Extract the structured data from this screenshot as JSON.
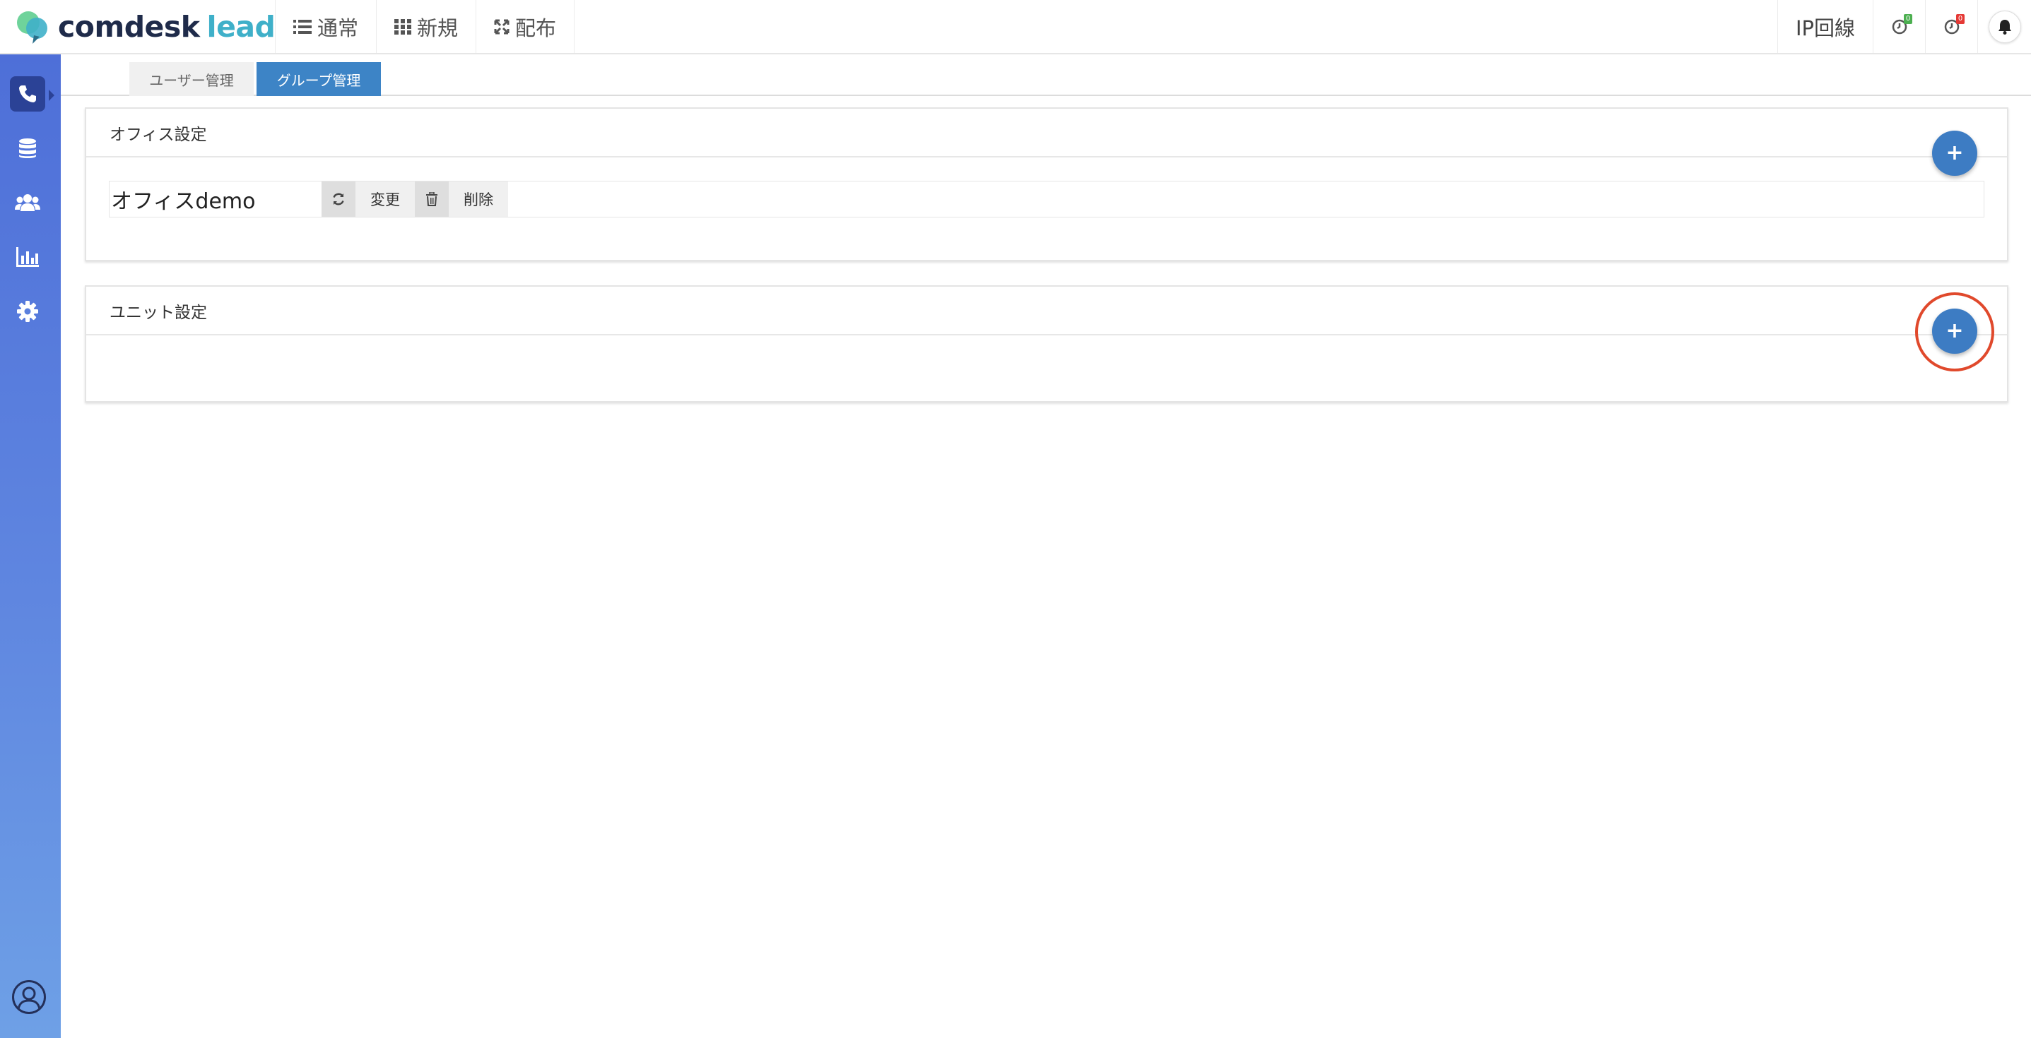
{
  "brand": {
    "name_primary": "comdesk",
    "name_secondary": "lead"
  },
  "nav": {
    "items": [
      {
        "label": "通常",
        "icon": "list-icon"
      },
      {
        "label": "新規",
        "icon": "grid-icon"
      },
      {
        "label": "配布",
        "icon": "expand-icon"
      }
    ]
  },
  "header_right": {
    "ip_line_label": "IP回線",
    "timer_green_badge": "0",
    "timer_red_badge": "0"
  },
  "sidebar": {
    "items": [
      "phone-icon",
      "database-icon",
      "users-icon",
      "bar-chart-icon",
      "gear-icon"
    ],
    "active_index": 0
  },
  "tabs": [
    {
      "label": "ユーザー管理",
      "active": false
    },
    {
      "label": "グループ管理",
      "active": true
    }
  ],
  "office_panel": {
    "title": "オフィス設定",
    "add_label": "+",
    "offices": [
      {
        "name": "オフィスdemo",
        "change_label": "変更",
        "delete_label": "削除"
      }
    ]
  },
  "unit_panel": {
    "title": "ユニット設定",
    "add_label": "+"
  },
  "colors": {
    "accent": "#3d7cc3",
    "tab_active": "#3d84c6",
    "sidebar_top": "#4e6fd8",
    "sidebar_bottom": "#6ea0e6",
    "highlight": "#e0492c",
    "badge_green": "#4caf50",
    "badge_red": "#e53935"
  }
}
